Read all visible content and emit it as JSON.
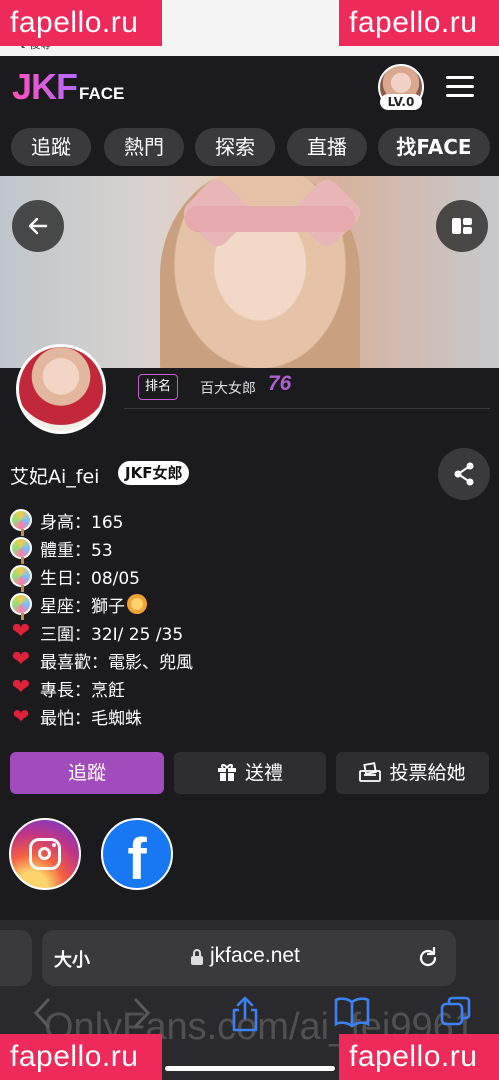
{
  "watermark": "fapello.ru",
  "status": {
    "back_label": "↙後等"
  },
  "header": {
    "logo_main": "JKF",
    "logo_sub": "FACE",
    "level": "LV.0"
  },
  "nav": {
    "tabs": [
      {
        "label": "追蹤"
      },
      {
        "label": "熱門"
      },
      {
        "label": "探索"
      },
      {
        "label": "直播"
      },
      {
        "label": "找FACE"
      }
    ]
  },
  "rank": {
    "label": "排名",
    "category": "百大女郎",
    "value": "76"
  },
  "profile": {
    "name": "艾妃Ai_fei",
    "badge": "JKF女郎",
    "details": [
      {
        "icon": "lollipop-icon",
        "text": "身高：165"
      },
      {
        "icon": "lollipop-icon",
        "text": "體重：53"
      },
      {
        "icon": "lollipop-icon",
        "text": "生日：08/05"
      },
      {
        "icon": "lollipop-icon",
        "text": "星座：獅子"
      },
      {
        "icon": "heart-icon",
        "text": "三圍：32I/ 25 /35"
      },
      {
        "icon": "heart-icon",
        "text": "最喜歡：電影、兜風"
      },
      {
        "icon": "heart-icon",
        "text": "專長：烹飪"
      },
      {
        "icon": "broken-heart-icon",
        "text": "最怕：毛蜘蛛"
      }
    ]
  },
  "actions": {
    "follow": "追蹤",
    "gift": "送禮",
    "vote": "投票給她"
  },
  "browser": {
    "text_size": "大小",
    "url": "jkface.net",
    "ghost_text": "OnlyFans.com/ai_fei9961"
  },
  "colors": {
    "accent": "#a14bbd",
    "rank_number": "#b05fd0",
    "watermark": "#ee2a5a",
    "background": "#1b1b1d"
  }
}
